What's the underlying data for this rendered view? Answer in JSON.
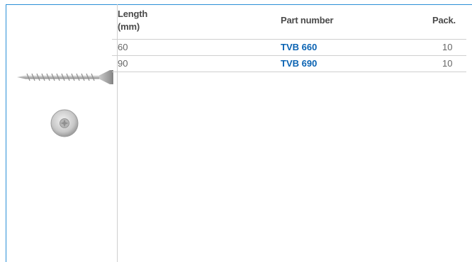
{
  "table": {
    "headers": {
      "length": "Length (mm)",
      "part_number": "Part number",
      "pack": "Pack."
    },
    "rows": [
      {
        "length": "60",
        "part_number": "TVB 660",
        "pack": "10"
      },
      {
        "length": "90",
        "part_number": "TVB 690",
        "pack": "10"
      }
    ]
  },
  "colors": {
    "accent_rule": "#2b8fd6",
    "part_number_text": "#0a63b3",
    "header_text": "#4a4a4a",
    "body_text": "#666666",
    "grid_line": "#cfcfcf"
  },
  "images": {
    "side_view": "countersunk-screw-side-icon",
    "head_view": "screw-head-top-icon"
  }
}
